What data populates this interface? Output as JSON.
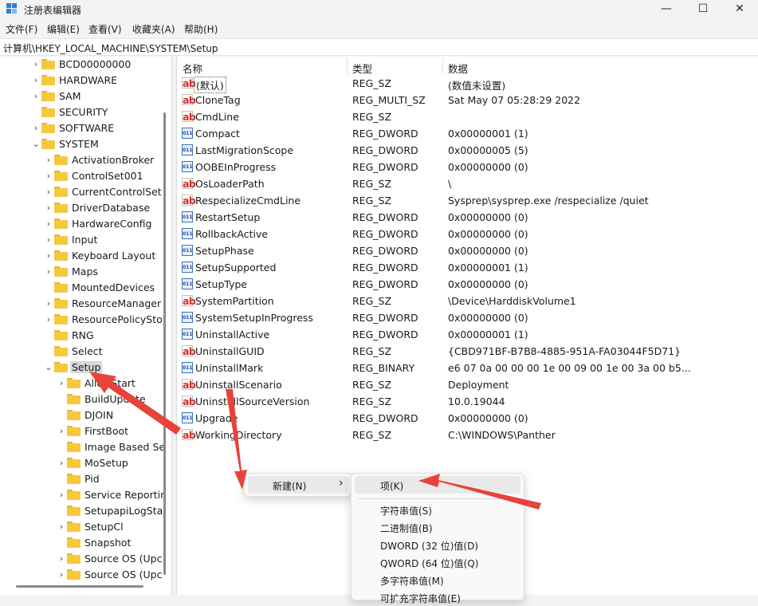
{
  "window": {
    "title": "注册表编辑器",
    "controls": {
      "minimize": "—",
      "maximize": "☐",
      "close": "✕"
    }
  },
  "menu": [
    "文件(F)",
    "编辑(E)",
    "查看(V)",
    "收藏夹(A)",
    "帮助(H)"
  ],
  "address": "计算机\\HKEY_LOCAL_MACHINE\\SYSTEM\\Setup",
  "tree": [
    {
      "label": "BCD00000000",
      "chev": "›"
    },
    {
      "label": "HARDWARE",
      "chev": "›"
    },
    {
      "label": "SAM",
      "chev": "›"
    },
    {
      "label": "SECURITY",
      "chev": ""
    },
    {
      "label": "SOFTWARE",
      "chev": "›"
    },
    {
      "label": "SYSTEM",
      "chev": "⌄"
    },
    {
      "label": "ActivationBroker",
      "chev": "›"
    },
    {
      "label": "ControlSet001",
      "chev": "›"
    },
    {
      "label": "CurrentControlSet",
      "chev": "›"
    },
    {
      "label": "DriverDatabase",
      "chev": "›"
    },
    {
      "label": "HardwareConfig",
      "chev": "›"
    },
    {
      "label": "Input",
      "chev": "›"
    },
    {
      "label": "Keyboard Layout",
      "chev": "›"
    },
    {
      "label": "Maps",
      "chev": "›"
    },
    {
      "label": "MountedDevices",
      "chev": ""
    },
    {
      "label": "ResourceManager",
      "chev": "›"
    },
    {
      "label": "ResourcePolicySto",
      "chev": "›"
    },
    {
      "label": "RNG",
      "chev": ""
    },
    {
      "label": "Select",
      "chev": ""
    },
    {
      "label": "Setup",
      "chev": "⌄",
      "selected": true
    },
    {
      "label": "AllowStart",
      "chev": "›"
    },
    {
      "label": "BuildUpdate",
      "chev": ""
    },
    {
      "label": "DJOIN",
      "chev": ""
    },
    {
      "label": "FirstBoot",
      "chev": "›"
    },
    {
      "label": "Image Based Se",
      "chev": ""
    },
    {
      "label": "MoSetup",
      "chev": "›"
    },
    {
      "label": "Pid",
      "chev": ""
    },
    {
      "label": "Service Reportin",
      "chev": "›"
    },
    {
      "label": "SetupapiLogSta",
      "chev": ""
    },
    {
      "label": "SetupCl",
      "chev": "›"
    },
    {
      "label": "Snapshot",
      "chev": ""
    },
    {
      "label": "Source OS (Upc",
      "chev": "›"
    },
    {
      "label": "Source OS (Upc",
      "chev": "›"
    }
  ],
  "columns": {
    "name": "名称",
    "type": "类型",
    "data": "数据"
  },
  "values": [
    {
      "name": "(默认)",
      "type": "REG_SZ",
      "data": "(数值未设置)",
      "icon": "ab"
    },
    {
      "name": "CloneTag",
      "type": "REG_MULTI_SZ",
      "data": "Sat May 07 05:28:29 2022",
      "icon": "ab"
    },
    {
      "name": "CmdLine",
      "type": "REG_SZ",
      "data": "",
      "icon": "ab"
    },
    {
      "name": "Compact",
      "type": "REG_DWORD",
      "data": "0x00000001 (1)",
      "icon": "011"
    },
    {
      "name": "LastMigrationScope",
      "type": "REG_DWORD",
      "data": "0x00000005 (5)",
      "icon": "011"
    },
    {
      "name": "OOBEInProgress",
      "type": "REG_DWORD",
      "data": "0x00000000 (0)",
      "icon": "011"
    },
    {
      "name": "OsLoaderPath",
      "type": "REG_SZ",
      "data": "\\",
      "icon": "ab"
    },
    {
      "name": "RespecializeCmdLine",
      "type": "REG_SZ",
      "data": "Sysprep\\sysprep.exe /respecialize /quiet",
      "icon": "ab"
    },
    {
      "name": "RestartSetup",
      "type": "REG_DWORD",
      "data": "0x00000000 (0)",
      "icon": "011"
    },
    {
      "name": "RollbackActive",
      "type": "REG_DWORD",
      "data": "0x00000000 (0)",
      "icon": "011"
    },
    {
      "name": "SetupPhase",
      "type": "REG_DWORD",
      "data": "0x00000000 (0)",
      "icon": "011"
    },
    {
      "name": "SetupSupported",
      "type": "REG_DWORD",
      "data": "0x00000001 (1)",
      "icon": "011"
    },
    {
      "name": "SetupType",
      "type": "REG_DWORD",
      "data": "0x00000000 (0)",
      "icon": "011"
    },
    {
      "name": "SystemPartition",
      "type": "REG_SZ",
      "data": "\\Device\\HarddiskVolume1",
      "icon": "ab"
    },
    {
      "name": "SystemSetupInProgress",
      "type": "REG_DWORD",
      "data": "0x00000000 (0)",
      "icon": "011"
    },
    {
      "name": "UninstallActive",
      "type": "REG_DWORD",
      "data": "0x00000001 (1)",
      "icon": "011"
    },
    {
      "name": "UninstallGUID",
      "type": "REG_SZ",
      "data": "{CBD971BF-B7B8-4885-951A-FA03044F5D71}",
      "icon": "ab"
    },
    {
      "name": "UninstallMark",
      "type": "REG_BINARY",
      "data": "e6 07 0a 00 00 00 1e 00 09 00 1e 00 3a 00 b5...",
      "icon": "011"
    },
    {
      "name": "UninstallScenario",
      "type": "REG_SZ",
      "data": "Deployment",
      "icon": "ab"
    },
    {
      "name": "UninstallSourceVersion",
      "type": "REG_SZ",
      "data": "10.0.19044",
      "icon": "ab"
    },
    {
      "name": "Upgrade",
      "type": "REG_DWORD",
      "data": "0x00000000 (0)",
      "icon": "011"
    },
    {
      "name": "WorkingDirectory",
      "type": "REG_SZ",
      "data": "C:\\WINDOWS\\Panther",
      "icon": "ab"
    }
  ],
  "context_menu": {
    "new_label": "新建(N)",
    "arrow": "›"
  },
  "submenu": [
    "项(K)",
    "字符串值(S)",
    "二进制值(B)",
    "DWORD (32 位)值(D)",
    "QWORD (64 位)值(Q)",
    "多字符串值(M)",
    "可扩充字符串值(E)"
  ],
  "colors": {
    "annotation_arrow": "#e8423a",
    "folder": "#f6c83d",
    "accent": "#2a7fd4"
  }
}
